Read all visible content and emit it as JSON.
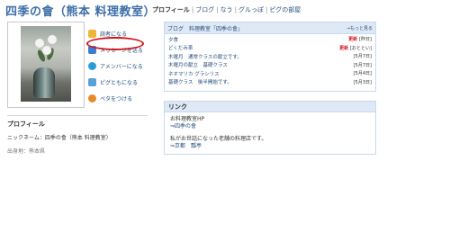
{
  "header": {
    "title": "四季の會（熊本 料理教室）"
  },
  "globalnav": {
    "items": [
      "プロフィール",
      "ブログ",
      "なう",
      "グルっぽ",
      "ピグの部屋"
    ],
    "separator": "|"
  },
  "actions": [
    {
      "label": "読者になる",
      "icon": "reader-icon"
    },
    {
      "label": "メッセージを送る",
      "icon": "message-icon"
    },
    {
      "label": "アメンバーになる",
      "icon": "member-icon"
    },
    {
      "label": "ピグともになる",
      "icon": "pigg-icon"
    },
    {
      "label": "ペタをつける",
      "icon": "footprint-icon"
    }
  ],
  "profile": {
    "heading": "プロフィール",
    "nickname": "ニックネーム：四季の會（熊本 料理教室）",
    "location": "出身地：熊本県"
  },
  "blog": {
    "title": "ブログ　料理教室「四季の會」",
    "more": "→もっと見る",
    "entries": [
      {
        "title": "夕食",
        "badge": "更新",
        "date": "[昨日]"
      },
      {
        "title": "どくだみ茶",
        "badge": "更新",
        "date": "[おととい]"
      },
      {
        "title": "木曜月　通常クラスの献立です。",
        "badge": "",
        "date": "[5月7日]"
      },
      {
        "title": "木曜月の献立　基礎クラス",
        "badge": "",
        "date": "[5月7日]"
      },
      {
        "title": "ネオマリカ グラシリス",
        "badge": "",
        "date": "[5月4日]"
      },
      {
        "title": "基礎クラス　後半開始です。",
        "badge": "",
        "date": "[5月3日]"
      }
    ]
  },
  "links": {
    "heading": "リンク",
    "lines": [
      {
        "text": "お料理教室HP",
        "is_link": false
      },
      {
        "text": "⇒四季の會",
        "is_link": true
      },
      {
        "text": "",
        "is_link": false
      },
      {
        "text": "私がお世話になった老舗の料理店です。",
        "is_link": false
      },
      {
        "text": "⇒京都　瓢亭",
        "is_link": true
      }
    ]
  },
  "colors": {
    "accent": "#3d6ea8",
    "link": "#2a4f7d",
    "box_header": "#dfe9f6",
    "annotation": "#d4141b"
  }
}
